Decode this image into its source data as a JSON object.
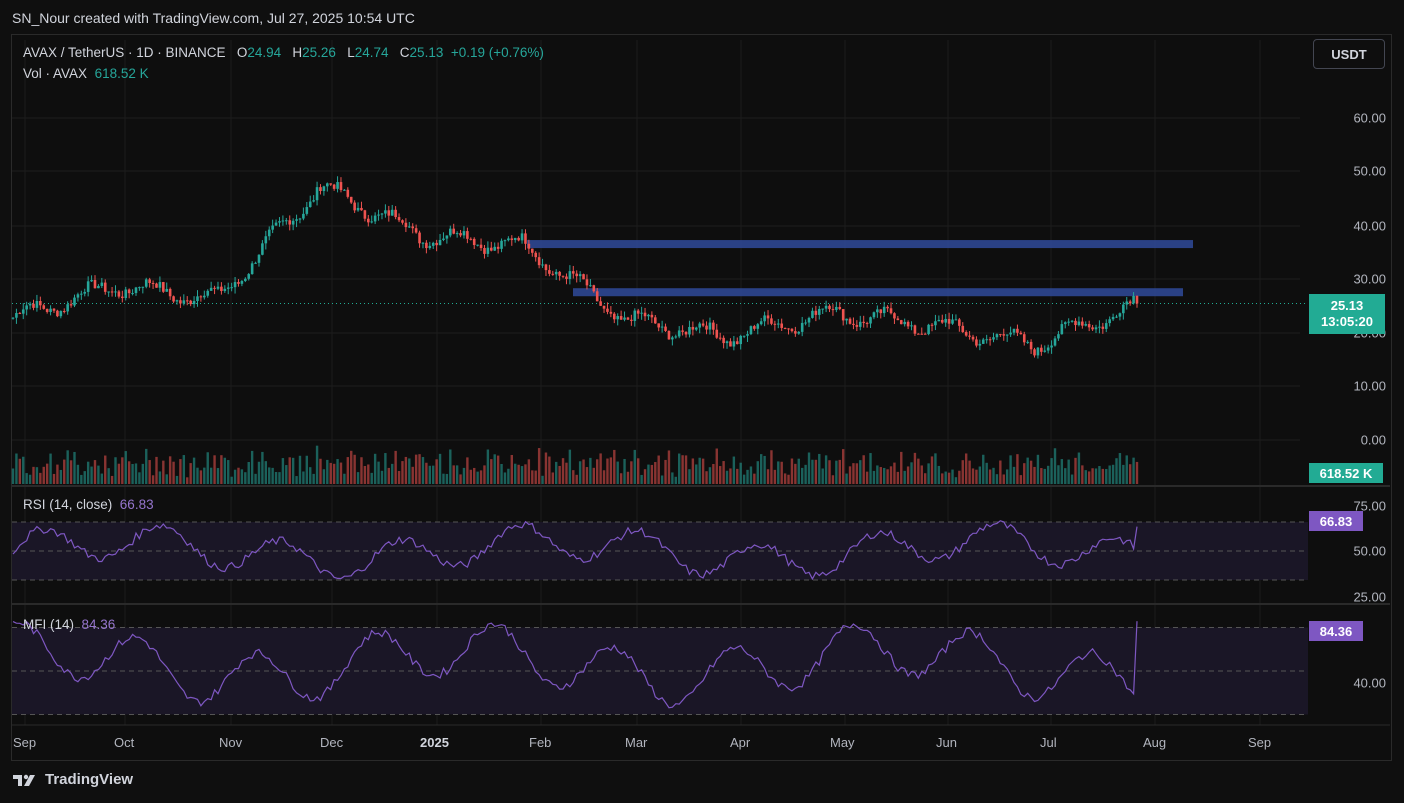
{
  "header": {
    "attribution": "SN_Nour created with TradingView.com, Jul 27, 2025 10:54 UTC"
  },
  "legend": {
    "symbol": "AVAX / TetherUS · 1D · BINANCE",
    "open_label": "O",
    "open": "24.94",
    "high_label": "H",
    "high": "25.26",
    "low_label": "L",
    "low": "24.74",
    "close_label": "C",
    "close": "25.13",
    "change": "+0.19 (+0.76%)",
    "vol_label": "Vol · AVAX",
    "vol": "618.52 K"
  },
  "currency_button": "USDT",
  "price_axis": [
    "60.00",
    "50.00",
    "40.00",
    "30.00",
    "20.00",
    "10.00",
    "0.00"
  ],
  "price_tag": {
    "price": "25.13",
    "countdown": "13:05:20"
  },
  "volume_tag": "618.52 K",
  "rsi": {
    "label": "RSI (14, close)",
    "value": "66.83",
    "axis": [
      "75.00",
      "50.00",
      "25.00"
    ]
  },
  "mfi": {
    "label": "MFI (14)",
    "value": "84.36",
    "axis": [
      "40.00"
    ]
  },
  "time_axis": [
    "Sep",
    "Oct",
    "Nov",
    "Dec",
    "2025",
    "Feb",
    "Mar",
    "Apr",
    "May",
    "Jun",
    "Jul",
    "Aug",
    "Sep"
  ],
  "footer": {
    "brand": "TradingView"
  },
  "colors": {
    "up": "#26a69a",
    "down": "#ef5350",
    "zone": "#2f4a9a",
    "osc": "#7e57c2",
    "accent": "#22ab94"
  },
  "chart_data": {
    "type": "candlestick",
    "symbol": "AVAX / TetherUS",
    "timeframe": "1D",
    "x": [
      "Sep",
      "Oct",
      "Nov",
      "Dec",
      "2025",
      "Feb",
      "Mar",
      "Apr",
      "May",
      "Jun",
      "Jul",
      "Aug"
    ],
    "approx_close": [
      22.5,
      28.5,
      26,
      47,
      38,
      36,
      22,
      19,
      23.5,
      21,
      17.5,
      25
    ],
    "ylim": [
      0,
      65
    ],
    "last": {
      "open": 24.94,
      "high": 25.26,
      "low": 24.74,
      "close": 25.13
    },
    "resistance_zones": [
      [
        35.5,
        37
      ],
      [
        26.5,
        28
      ]
    ],
    "rsi_last": 66.83,
    "mfi_last": 84.36
  }
}
